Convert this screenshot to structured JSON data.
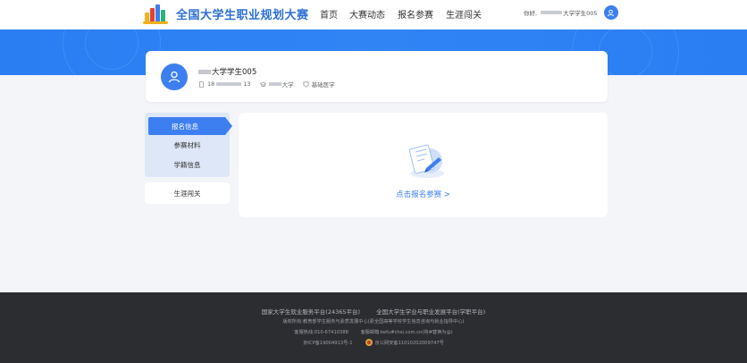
{
  "header": {
    "site_title": "全国大学生职业规划大赛",
    "nav": [
      "首页",
      "大赛动态",
      "报名参赛",
      "生涯闯关"
    ],
    "greeting": "你好,",
    "user_name_suffix": "大学学生005"
  },
  "profile": {
    "name_suffix": "大学学生005",
    "phone_prefix": "18",
    "phone_suffix": "13",
    "school_suffix": "大学",
    "major": "基础医学"
  },
  "sidebar": {
    "items": [
      "报名信息",
      "参赛材料",
      "学籍信息"
    ],
    "extra": "生涯闯关"
  },
  "main": {
    "cta": "点击报名参赛 >"
  },
  "footer": {
    "platform_1": "国家大学生就业服务平台(24365平台)",
    "platform_2": "全国大学生学业与职业发展平台(学职平台)",
    "copyright": "版权所有:教育部学生服务与素质发展中心(原全国高等学校学生信息咨询与就业指导中心)",
    "hotline": "客服热线:010-67410388",
    "email": "客服邮箱:kefu#chsi.com.cn(将#替换为@)",
    "icp": "京ICP备19004913号-1",
    "police": "京公网安备11010202009747号"
  },
  "colors": {
    "brand_blue": "#3d7ff0",
    "banner_blue": "#2a7ef2",
    "footer_bg": "#2b2d31"
  }
}
